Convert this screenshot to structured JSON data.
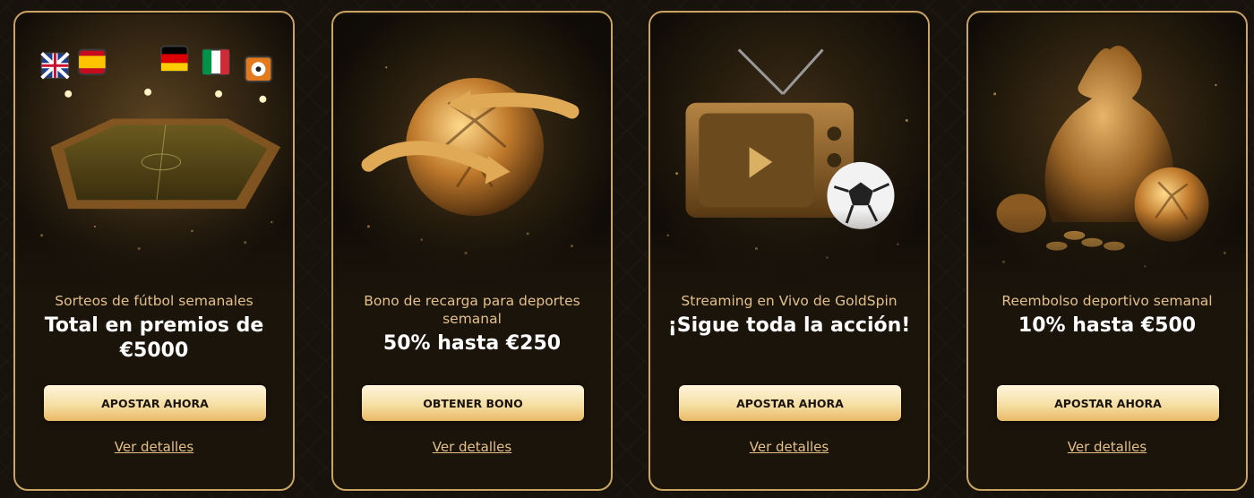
{
  "promos": [
    {
      "subtitle": "Sorteos de fútbol semanales",
      "title": "Total en premios de €5000",
      "cta": "APOSTAR AHORA",
      "details": "Ver detalles"
    },
    {
      "subtitle": "Bono de recarga para deportes semanal",
      "title": "50% hasta €250",
      "cta": "OBTENER BONO",
      "details": "Ver detalles"
    },
    {
      "subtitle": "Streaming en Vivo de GoldSpin",
      "title": "¡Sigue toda la acción!",
      "cta": "APOSTAR AHORA",
      "details": "Ver detalles"
    },
    {
      "subtitle": "Reembolso deportivo semanal",
      "title": "10% hasta €500",
      "cta": "APOSTAR AHORA",
      "details": "Ver detalles"
    }
  ],
  "league_flags": [
    "uk-flag-icon",
    "spain-flag-icon",
    "germany-flag-icon",
    "italy-flag-icon",
    "football-icon"
  ],
  "colors": {
    "gold": "#c9a463",
    "accent_text": "#e3c08a",
    "background": "#1b140b"
  }
}
